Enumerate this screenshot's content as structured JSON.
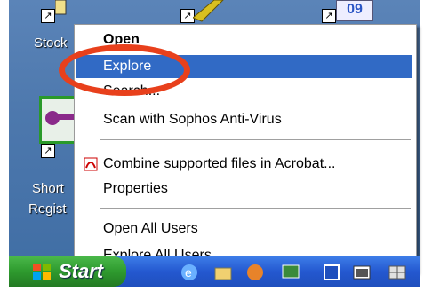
{
  "desktop": {
    "icons": [
      {
        "label": "Stock"
      },
      {
        "label": "Short"
      },
      {
        "label": "Regist"
      }
    ],
    "top_icon_badge": "09"
  },
  "context_menu": {
    "items": [
      {
        "label": "Open",
        "bold": true
      },
      {
        "label": "Explore",
        "highlighted": true
      },
      {
        "label": "Search..."
      },
      {
        "label": "Scan with Sophos Anti-Virus"
      },
      {
        "label": "Combine supported files in Acrobat...",
        "icon": "acrobat-icon"
      },
      {
        "label": "Properties"
      },
      {
        "label": "Open All Users"
      },
      {
        "label": "Explore All Users"
      }
    ]
  },
  "taskbar": {
    "start_label": "Start"
  },
  "colors": {
    "highlight": "#316ac5",
    "annotation": "#e8401c",
    "start_green": "#2e9a2e",
    "taskbar_blue": "#2458d0"
  }
}
